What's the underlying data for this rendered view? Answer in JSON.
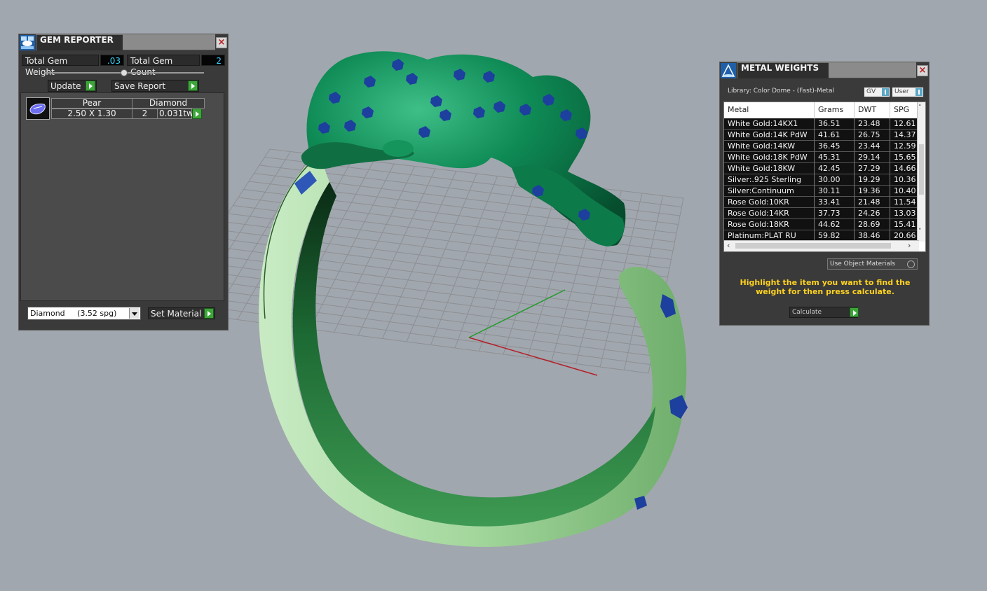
{
  "gem_reporter": {
    "title": "GEM REPORTER",
    "total_weight_label": "Total Gem Weight",
    "total_weight_value": ".03",
    "total_count_label": "Total Gem Count",
    "total_count_value": "2",
    "update_label": "Update",
    "save_report_label": "Save Report",
    "gem": {
      "shape": "Pear",
      "type": "Diamond",
      "size": "2.50 X 1.30",
      "count": "2",
      "weight": "0.031tw"
    },
    "material_select": "Diamond     (3.52 spg)",
    "set_material_label": "Set Material"
  },
  "metal_weights": {
    "title": "METAL WEIGHTS",
    "library": "Library: Color Dome - (Fast)-Metal",
    "gv_label": "GV",
    "user_label": "User",
    "columns": [
      "Metal",
      "Grams",
      "DWT",
      "SPG"
    ],
    "rows": [
      {
        "metal": "White Gold:14KX1",
        "grams": "36.51",
        "dwt": "23.48",
        "spg": "12.61"
      },
      {
        "metal": "White Gold:14K PdW",
        "grams": "41.61",
        "dwt": "26.75",
        "spg": "14.37"
      },
      {
        "metal": "White Gold:14KW",
        "grams": "36.45",
        "dwt": "23.44",
        "spg": "12.59"
      },
      {
        "metal": "White Gold:18K PdW",
        "grams": "45.31",
        "dwt": "29.14",
        "spg": "15.65"
      },
      {
        "metal": "White Gold:18KW",
        "grams": "42.45",
        "dwt": "27.29",
        "spg": "14.66"
      },
      {
        "metal": "Silver:.925 Sterling",
        "grams": "30.00",
        "dwt": "19.29",
        "spg": "10.36"
      },
      {
        "metal": "Silver:Continuum",
        "grams": "30.11",
        "dwt": "19.36",
        "spg": "10.40"
      },
      {
        "metal": "Rose Gold:10KR",
        "grams": "33.41",
        "dwt": "21.48",
        "spg": "11.54"
      },
      {
        "metal": "Rose Gold:14KR",
        "grams": "37.73",
        "dwt": "24.26",
        "spg": "13.03"
      },
      {
        "metal": "Rose Gold:18KR",
        "grams": "44.62",
        "dwt": "28.69",
        "spg": "15.41"
      },
      {
        "metal": "Platinum:PLAT RU",
        "grams": "59.82",
        "dwt": "38.46",
        "spg": "20.66"
      }
    ],
    "use_object_materials": "Use Object Materials",
    "instruction": "Highlight the item you want to find the weight for then press calculate.",
    "calculate_label": "Calculate"
  },
  "colors": {
    "background": "#a1a7ae",
    "panel": "#3a3a3a",
    "value_text": "#3ad5ff",
    "go_button": "#3da63a",
    "instruction_text": "#ffd21f",
    "model_green": "#0f7d4f",
    "band_green": "#a8d8a3",
    "spots": "#1d3f9e"
  },
  "icons": [
    "gem-reporter-logo-icon",
    "metal-weights-logo-icon",
    "close-icon",
    "pear-diamond-icon",
    "go-arrow-icon",
    "dropdown-arrow-icon"
  ]
}
